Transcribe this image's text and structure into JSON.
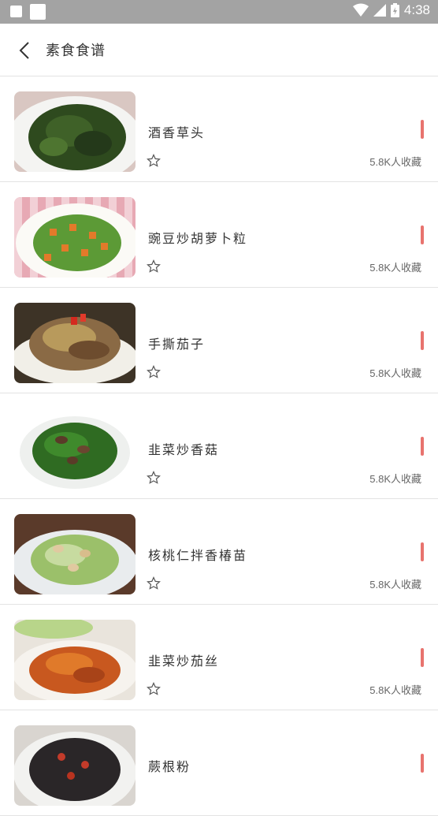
{
  "status_bar": {
    "time": "4:38"
  },
  "header": {
    "title": "素食食谱"
  },
  "items": [
    {
      "name": "酒香草头",
      "favorites": "5.8K人收藏"
    },
    {
      "name": "豌豆炒胡萝卜粒",
      "favorites": "5.8K人收藏"
    },
    {
      "name": "手撕茄子",
      "favorites": "5.8K人收藏"
    },
    {
      "name": "韭菜炒香菇",
      "favorites": "5.8K人收藏"
    },
    {
      "name": "核桃仁拌香椿苗",
      "favorites": "5.8K人收藏"
    },
    {
      "name": "韭菜炒茄丝",
      "favorites": "5.8K人收藏"
    },
    {
      "name": "蕨根粉",
      "favorites": ""
    }
  ],
  "colors": {
    "accent": "#e8736e",
    "statusbar": "#a3a3a3"
  }
}
